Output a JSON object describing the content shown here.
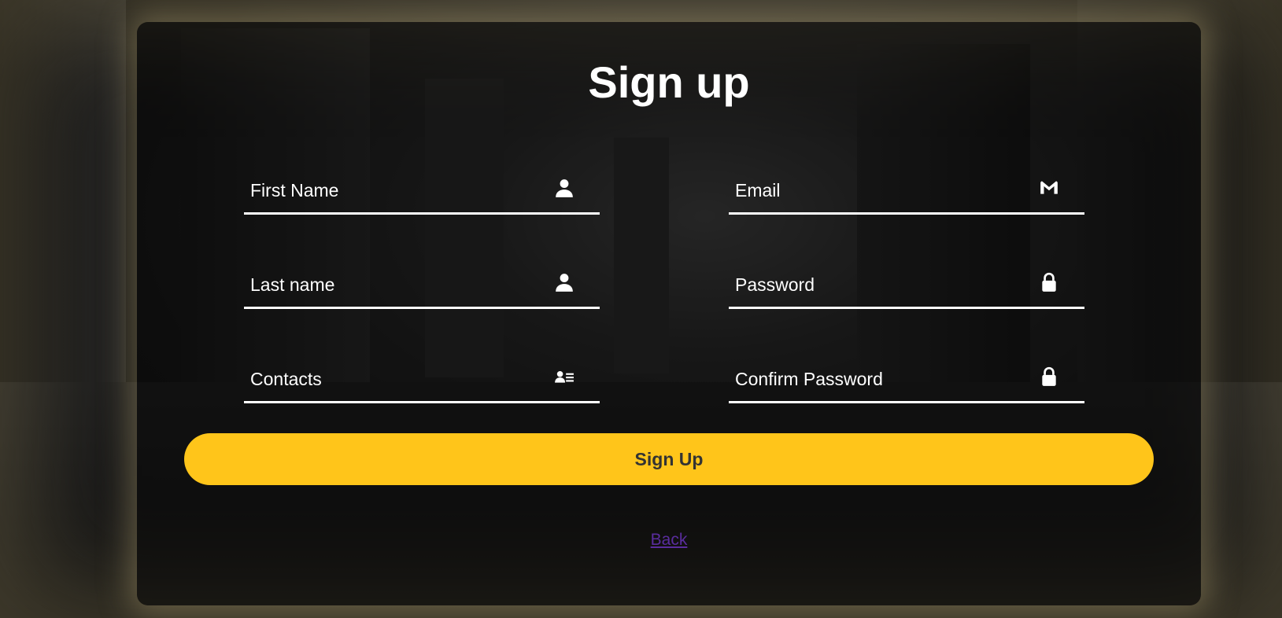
{
  "form": {
    "title": "Sign up",
    "fields": {
      "first_name": {
        "placeholder": "First Name",
        "icon": "user-icon"
      },
      "last_name": {
        "placeholder": "Last name",
        "icon": "user-icon"
      },
      "contacts": {
        "placeholder": "Contacts",
        "icon": "contact-card-icon"
      },
      "email": {
        "placeholder": "Email",
        "icon": "gmail-icon"
      },
      "password": {
        "placeholder": "Password",
        "icon": "lock-icon"
      },
      "confirm_password": {
        "placeholder": "Confirm Password",
        "icon": "lock-icon"
      }
    },
    "submit_label": "Sign Up",
    "back_link": "Back"
  },
  "colors": {
    "accent": "#ffc51a",
    "link": "#5a2d9e",
    "text": "#ffffff"
  }
}
